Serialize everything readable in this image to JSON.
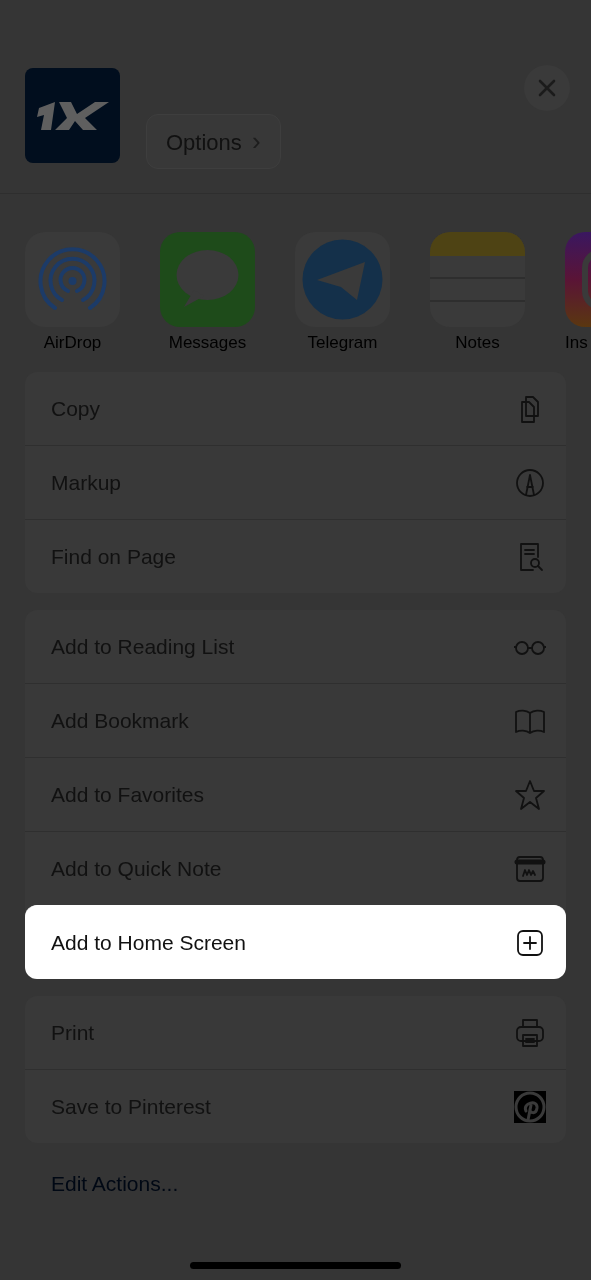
{
  "header": {
    "options_label": "Options",
    "options_chevron": "›"
  },
  "apps": [
    {
      "label": "AirDrop",
      "kind": "airdrop"
    },
    {
      "label": "Messages",
      "kind": "messages"
    },
    {
      "label": "Telegram",
      "kind": "telegram"
    },
    {
      "label": "Notes",
      "kind": "notes"
    },
    {
      "label": "Ins",
      "kind": "instagram"
    }
  ],
  "action_groups": [
    {
      "actions": [
        {
          "label": "Copy",
          "kind": "copy",
          "highlighted": false
        },
        {
          "label": "Markup",
          "kind": "markup",
          "highlighted": false
        },
        {
          "label": "Find on Page",
          "kind": "find",
          "highlighted": false
        }
      ]
    },
    {
      "actions": [
        {
          "label": "Add to Reading List",
          "kind": "glasses",
          "highlighted": false
        },
        {
          "label": "Add Bookmark",
          "kind": "book",
          "highlighted": false
        },
        {
          "label": "Add to Favorites",
          "kind": "star",
          "highlighted": false
        },
        {
          "label": "Add to Quick Note",
          "kind": "quicknote",
          "highlighted": false
        },
        {
          "label": "Add to Home Screen",
          "kind": "addsquare",
          "highlighted": true
        }
      ]
    },
    {
      "actions": [
        {
          "label": "Print",
          "kind": "print",
          "highlighted": false
        },
        {
          "label": "Save to Pinterest",
          "kind": "pinterest",
          "highlighted": false
        }
      ]
    }
  ],
  "edit_actions": "Edit Actions..."
}
